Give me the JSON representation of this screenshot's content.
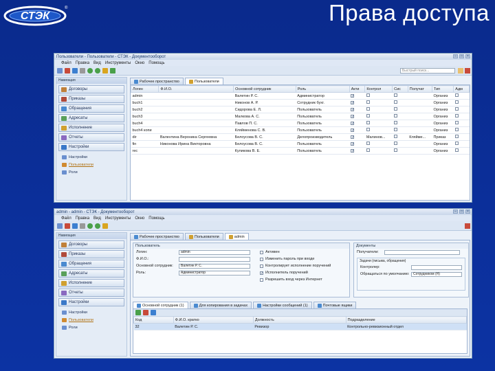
{
  "slide": {
    "title": "Права доступа",
    "logo_text": "СТЭК"
  },
  "w1": {
    "title": "Пользователи - Пользователи - СТЭК - Документооборот",
    "menu": [
      "Файл",
      "Правка",
      "Вид",
      "Инструменты",
      "Окно",
      "Помощь"
    ],
    "search_placeholder": "Быстрый поиск...",
    "nav_head": "Навигация",
    "nav_groups": [
      "Договоры",
      "Приказы",
      "Обращения",
      "Адресаты",
      "Исполнение",
      "Отчеты",
      "Настройки"
    ],
    "nav_sub": [
      "Настройки",
      "Пользователи",
      "Роли"
    ],
    "tabs": [
      "Рабочее пространство",
      "Пользователи"
    ],
    "columns": [
      "Логин",
      "Ф.И.О.",
      "Основной сотрудник",
      "Роль",
      "Акти",
      "Контрол",
      "Сис",
      "Получат",
      "Тип",
      "Адм"
    ],
    "rows": [
      [
        "admin",
        "",
        "Валетин Р. С.",
        "Администратор",
        "on",
        "off",
        "off",
        "",
        "Организ",
        "off"
      ],
      [
        "buch1",
        "",
        "Никонов А. Р.",
        "Сотрудник бухг.",
        "on",
        "off",
        "off",
        "",
        "Организ",
        "off"
      ],
      [
        "buch2",
        "",
        "Сидорова Е. Л.",
        "Пользователь",
        "on",
        "off",
        "off",
        "",
        "Организ",
        "off"
      ],
      [
        "buch3",
        "",
        "Малкова А. С.",
        "Пользователь",
        "on",
        "off",
        "off",
        "",
        "Организ",
        "off"
      ],
      [
        "buch4",
        "",
        "Павлов П. С.",
        "Пользователь",
        "on",
        "off",
        "off",
        "",
        "Организ",
        "off"
      ],
      [
        "buch4 копи",
        "",
        "Кляйменова С. В.",
        "Пользователь",
        "on",
        "off",
        "off",
        "",
        "Организ",
        "off"
      ],
      [
        "dir",
        "Валентина Вероника Сергеевна",
        "Белоусова В. С.",
        "Делопроизводитель",
        "on",
        "Малинов...",
        "off",
        "Кляйме...",
        "Приказ",
        "off"
      ],
      [
        "fin",
        "Никонова Ирина Викторовна",
        "Белоусова В. С.",
        "Пользователь",
        "on",
        "off",
        "off",
        "",
        "Организ",
        "off"
      ],
      [
        "rec",
        "",
        "Куликова В. Е.",
        "Пользователь",
        "on",
        "off",
        "off",
        "",
        "Организ",
        "off"
      ]
    ]
  },
  "w2": {
    "title": "admin - admin - СТЭК - Документооборот",
    "menu": [
      "Файл",
      "Правка",
      "Вид",
      "Инструменты",
      "Окно",
      "Помощь"
    ],
    "nav_head": "Навигация",
    "nav_groups": [
      "Договоры",
      "Приказы",
      "Обращения",
      "Адресаты",
      "Исполнение",
      "Отчеты",
      "Настройки"
    ],
    "nav_sub": [
      "Настройки",
      "Пользователи",
      "Роли"
    ],
    "tabs": [
      "Рабочее пространство",
      "Пользователи",
      "admin"
    ],
    "user_panel": {
      "head": "Пользователь",
      "fields": [
        {
          "label": "Логин:",
          "value": "admin"
        },
        {
          "label": "Ф.И.О.:",
          "value": ""
        },
        {
          "label": "Основной сотрудник:",
          "value": "Валетин Р. С."
        },
        {
          "label": "Роль:",
          "value": "Администратор"
        }
      ],
      "checks": [
        {
          "label": "Активен",
          "on": false
        },
        {
          "label": "Изменить пароль при входе",
          "on": false
        },
        {
          "label": "Контролирует исполнение поручений",
          "on": false
        },
        {
          "label": "Исполнитель поручений",
          "on": true
        },
        {
          "label": "Разрешить вход через Интернет",
          "on": false
        }
      ]
    },
    "doc_panel": {
      "head": "Документы",
      "field1": "Получатели:",
      "section": "Задачи (письма, обращения)",
      "field2": "Контролер:",
      "field3": "Обращаться по умолчанию:",
      "field3_value": "Сотрудником (H)"
    },
    "bottom_tabs": [
      "Основной сотрудник (1)",
      "Для копирования в задачах",
      "Настройки сообщений (1)",
      "Почтовые ящики"
    ],
    "bottom_columns": [
      "Код",
      "Ф.И.О. кратко",
      "Должность",
      "Подразделение"
    ],
    "bottom_rows": [
      [
        "32",
        "Валетин Р. С.",
        "Ревизор",
        "Контрольно-ревизионный отдел"
      ]
    ]
  }
}
